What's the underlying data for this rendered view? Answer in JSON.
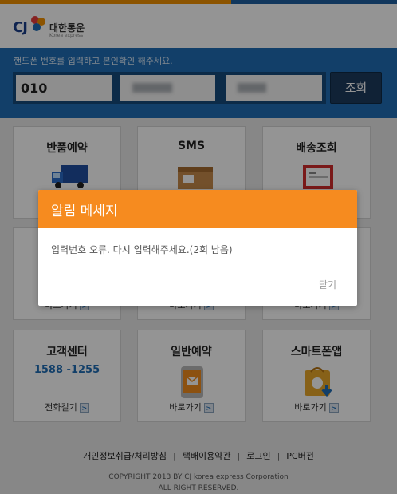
{
  "header": {
    "logo_cj": "CJ",
    "brand": "대한통운",
    "brand_sub": "Korea express"
  },
  "search": {
    "instruction": "핸드폰 번호를 입력하고 본인확인 해주세요.",
    "phone_part1": "010",
    "phone_part2": "",
    "phone_part3": "",
    "submit_label": "조회"
  },
  "tiles": [
    {
      "title": "반품예약",
      "link": "",
      "icon": "delivery-truck-icon"
    },
    {
      "title": "SMS",
      "link": "",
      "icon": "parcel-box-icon"
    },
    {
      "title": "배송조회",
      "link": "",
      "icon": "waybill-icon"
    },
    {
      "title": "",
      "link": "바로가기",
      "icon": ""
    },
    {
      "title": "",
      "link": "바로가기",
      "icon": ""
    },
    {
      "title": "",
      "link": "바로가기",
      "icon": ""
    },
    {
      "title": "고객센터",
      "phone": "1588 -1255",
      "link": "전화걸기",
      "icon": ""
    },
    {
      "title": "일반예약",
      "link": "바로가기",
      "icon": "mobile-mail-icon"
    },
    {
      "title": "스마트폰앱",
      "link": "바로가기",
      "icon": "app-bag-icon"
    }
  ],
  "footer": {
    "links": [
      "개인정보취급/처리방침",
      "택배이용약관",
      "로그인",
      "PC버전"
    ],
    "copyright_line1": "COPYRIGHT 2013 BY CJ korea express Corporation",
    "copyright_line2": "ALL RIGHT RESERVED."
  },
  "modal": {
    "title": "알림 메세지",
    "message": "입력번호 오류. 다시 입력해주세요.(2회 남음)",
    "close_label": "닫기"
  },
  "colors": {
    "primary_blue": "#1f6db5",
    "modal_orange": "#f68b1f",
    "top_accent": "#f29100"
  }
}
